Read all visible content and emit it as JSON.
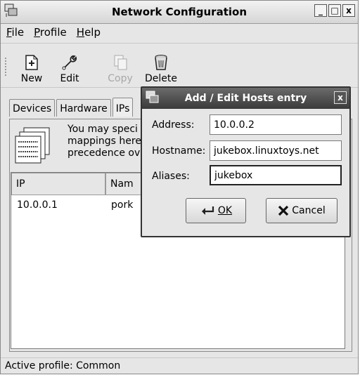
{
  "window": {
    "title": "Network Configuration",
    "controls": {
      "minimize": "_",
      "maximize": "□",
      "close": "x"
    }
  },
  "menu": {
    "items": [
      {
        "label": "File",
        "mnemonic": "F"
      },
      {
        "label": "Profile",
        "mnemonic": "P"
      },
      {
        "label": "Help",
        "mnemonic": "H"
      }
    ]
  },
  "toolbar": {
    "new_label": "New",
    "edit_label": "Edit",
    "copy_label": "Copy",
    "delete_label": "Delete",
    "copy_disabled": true
  },
  "tabs": [
    "Devices",
    "Hardware",
    "IPs"
  ],
  "main": {
    "description_lines": [
      "You may speci",
      "mappings here.",
      "precedence ove"
    ],
    "table": {
      "headers": [
        "IP",
        "Nam"
      ],
      "rows": [
        [
          "10.0.0.1",
          "pork"
        ]
      ]
    },
    "status": "Active profile: Common"
  },
  "dialog": {
    "title": "Add / Edit Hosts entry",
    "close_glyph": "x",
    "address_label": "Address:",
    "address_value": "10.0.0.2",
    "hostname_label": "Hostname:",
    "hostname_value": "jukebox.linuxtoys.net",
    "aliases_label": "Aliases:",
    "aliases_value": "jukebox",
    "ok_label": "OK",
    "cancel_label": "Cancel"
  }
}
